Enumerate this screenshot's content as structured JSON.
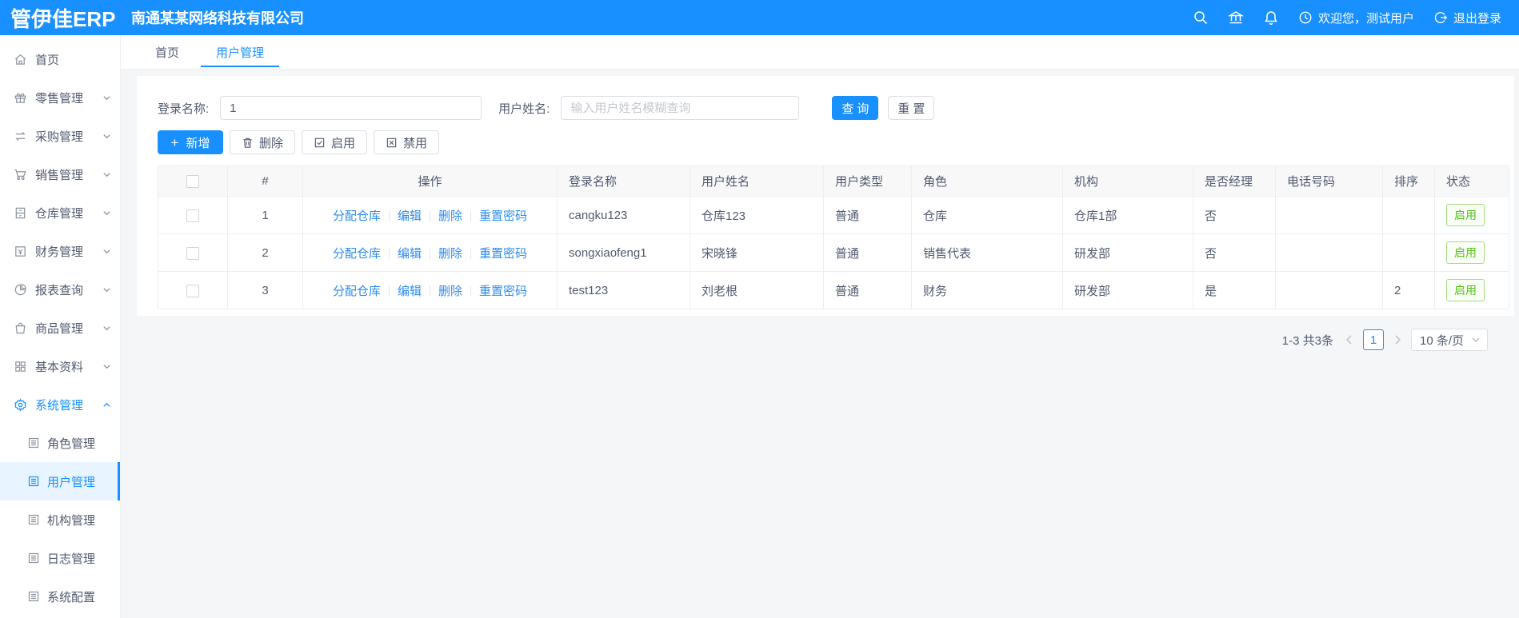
{
  "colors": {
    "primary": "#1890ff",
    "link": "#2d8cf0",
    "success": "#52c41a"
  },
  "header": {
    "logo": "管伊佳ERP",
    "company": "南通某某网络科技有限公司",
    "welcome": "欢迎您，测试用户",
    "logout": "退出登录"
  },
  "sidebar": {
    "items": [
      {
        "label": "首页"
      },
      {
        "label": "零售管理"
      },
      {
        "label": "采购管理"
      },
      {
        "label": "销售管理"
      },
      {
        "label": "仓库管理"
      },
      {
        "label": "财务管理"
      },
      {
        "label": "报表查询"
      },
      {
        "label": "商品管理"
      },
      {
        "label": "基本资料"
      },
      {
        "label": "系统管理"
      }
    ],
    "system_children": [
      {
        "label": "角色管理"
      },
      {
        "label": "用户管理"
      },
      {
        "label": "机构管理"
      },
      {
        "label": "日志管理"
      },
      {
        "label": "系统配置"
      }
    ]
  },
  "tabs": [
    {
      "label": "首页"
    },
    {
      "label": "用户管理"
    }
  ],
  "filters": {
    "login_label": "登录名称:",
    "login_value": "1",
    "name_label": "用户姓名:",
    "name_placeholder": "输入用户姓名模糊查询",
    "search": "查 询",
    "reset": "重 置"
  },
  "toolbar": {
    "add_icon": "+",
    "add": "新增",
    "del": "删除",
    "enable": "启用",
    "disable": "禁用"
  },
  "table": {
    "columns": [
      "#",
      "操作",
      "登录名称",
      "用户姓名",
      "用户类型",
      "角色",
      "机构",
      "是否经理",
      "电话号码",
      "排序",
      "状态"
    ],
    "op_labels": [
      "分配仓库",
      "编辑",
      "删除",
      "重置密码"
    ],
    "rows": [
      {
        "idx": "1",
        "login": "cangku123",
        "name": "仓库123",
        "type": "普通",
        "role": "仓库",
        "org": "仓库1部",
        "manager": "否",
        "phone": "",
        "sort": "",
        "status": "启用"
      },
      {
        "idx": "2",
        "login": "songxiaofeng1",
        "name": "宋晓锋",
        "type": "普通",
        "role": "销售代表",
        "org": "研发部",
        "manager": "否",
        "phone": "",
        "sort": "",
        "status": "启用"
      },
      {
        "idx": "3",
        "login": "test123",
        "name": "刘老根",
        "type": "普通",
        "role": "财务",
        "org": "研发部",
        "manager": "是",
        "phone": "",
        "sort": "2",
        "status": "启用"
      }
    ]
  },
  "pagination": {
    "total": "1-3 共3条",
    "page": "1",
    "size": "10 条/页"
  }
}
